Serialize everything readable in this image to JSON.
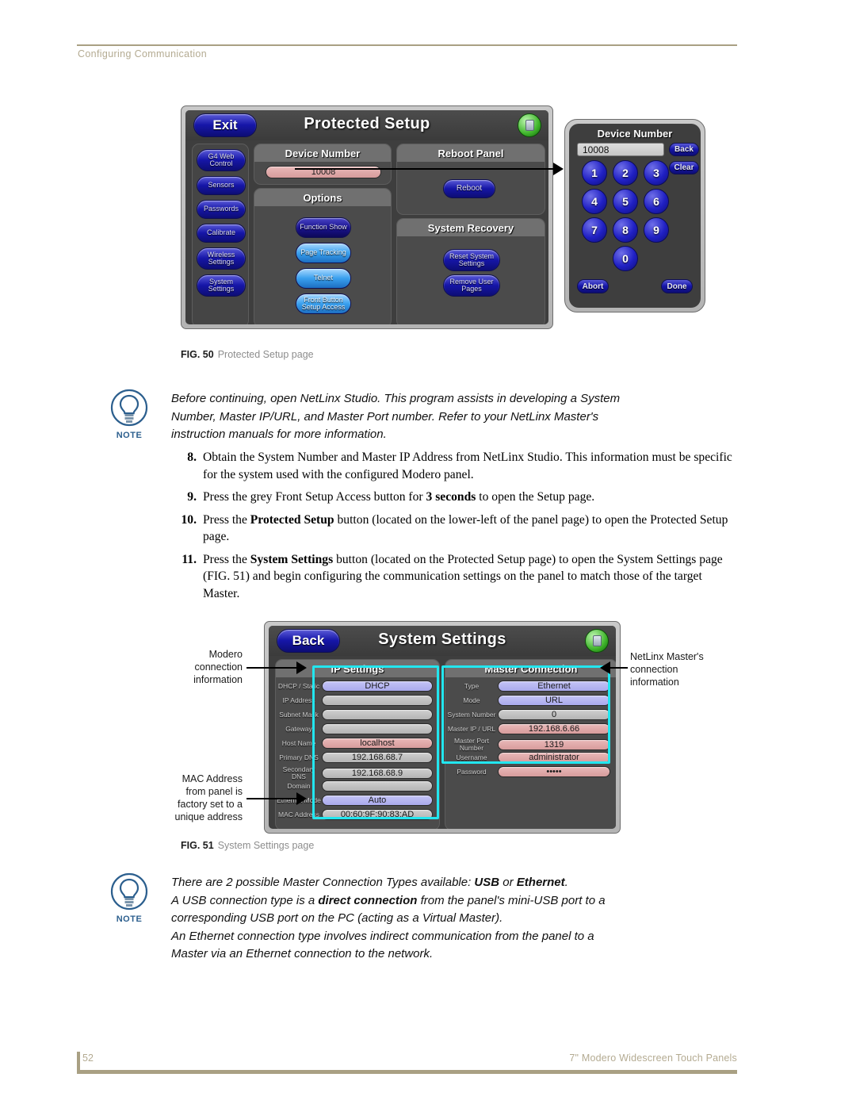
{
  "header": {
    "running_head": "Configuring Communication"
  },
  "footer": {
    "page_number": "52",
    "doc_title": "7\" Modero Widescreen Touch Panels"
  },
  "figure50": {
    "caption_label": "FIG. 50",
    "caption_text": "Protected Setup page",
    "panel": {
      "title": "Protected Setup",
      "exit_button": "Exit",
      "lock_icon": "lock-icon",
      "sidebar_buttons": [
        "G4 Web Control",
        "Sensors",
        "Passwords",
        "Calibrate",
        "Wireless Settings",
        "System Settings"
      ],
      "device_number_group": {
        "title": "Device Number",
        "value": "10008"
      },
      "options_group": {
        "title": "Options",
        "buttons": [
          "Function Show",
          "Page Tracking",
          "Telnet",
          "Front Button Setup Access"
        ]
      },
      "reboot_group": {
        "title": "Reboot Panel",
        "button": "Reboot"
      },
      "recovery_group": {
        "title": "System Recovery",
        "buttons": [
          "Reset System Settings",
          "Remove User Pages"
        ]
      }
    },
    "keypad": {
      "title": "Device Number",
      "field_value": "10008",
      "side_buttons": [
        "Back",
        "Clear"
      ],
      "digits": [
        "1",
        "2",
        "3",
        "4",
        "5",
        "6",
        "7",
        "8",
        "9",
        "0"
      ],
      "abort_button": "Abort",
      "done_button": "Done"
    }
  },
  "note1": {
    "icon_label": "NOTE",
    "lines": [
      "Before continuing, open NetLinx Studio. This program assists in developing a System",
      "Number, Master IP/URL, and Master Port number. Refer to your NetLinx Master's",
      "instruction manuals for more information."
    ]
  },
  "steps": [
    {
      "num": "8.",
      "html": "Obtain the System Number and Master IP Address from NetLinx Studio. This information must be specific for the system used with the configured Modero panel."
    },
    {
      "num": "9.",
      "html": "Press the grey Front Setup Access button for <b>3 seconds</b> to open the Setup page."
    },
    {
      "num": "10.",
      "html": "Press the <b>Protected Setup</b> button (located on the lower-left of the panel page) to open the Protected Setup page."
    },
    {
      "num": "11.",
      "html": "Press the <b>System Settings</b> button (located on the Protected Setup page) to open the System Settings page (FIG. 51) and begin configuring the communication settings on the panel to match those of the target Master."
    }
  ],
  "figure51": {
    "caption_label": "FIG. 51",
    "caption_text": "System Settings page",
    "panel": {
      "title": "System Settings",
      "back_button": "Back",
      "lock_icon": "lock-icon",
      "ip_settings": {
        "title": "IP Settings",
        "rows": [
          {
            "label": "DHCP / Static",
            "value": "DHCP",
            "style": "blue"
          },
          {
            "label": "IP Address",
            "value": "",
            "style": "grey"
          },
          {
            "label": "Subnet Mask",
            "value": "",
            "style": "grey"
          },
          {
            "label": "Gateway",
            "value": "",
            "style": "grey"
          },
          {
            "label": "Host Name",
            "value": "localhost",
            "style": "rose"
          },
          {
            "label": "Primary DNS",
            "value": "192.168.68.7",
            "style": "grey"
          },
          {
            "label": "Secondary DNS",
            "value": "192.168.68.9",
            "style": "grey"
          },
          {
            "label": "Domain",
            "value": "",
            "style": "grey"
          },
          {
            "label": "Ethernet Mode",
            "value": "Auto",
            "style": "blue"
          },
          {
            "label": "MAC Address",
            "value": "00:60:9F:90:83:AD",
            "style": "grey"
          }
        ]
      },
      "master_connection": {
        "title": "Master Connection",
        "rows": [
          {
            "label": "Type",
            "value": "Ethernet",
            "style": "blue"
          },
          {
            "label": "Mode",
            "value": "URL",
            "style": "blue"
          },
          {
            "label": "System Number",
            "value": "0",
            "style": "grey"
          },
          {
            "label": "Master IP / URL",
            "value": "192.168.6.66",
            "style": "rose"
          },
          {
            "label": "Master Port Number",
            "value": "1319",
            "style": "rose"
          },
          {
            "label": "Username",
            "value": "administrator",
            "style": "rose"
          },
          {
            "label": "Password",
            "value": "•••••",
            "style": "rose"
          }
        ]
      }
    },
    "annotations": {
      "left_top": "Modero\nconnection\ninformation",
      "left_bottom": "MAC Address\nfrom panel is\nfactory set to a\nunique address",
      "right_top": "NetLinx Master's\nconnection\ninformation"
    }
  },
  "note2": {
    "icon_label": "NOTE",
    "lines_html": [
      "There are 2 possible Master Connection Types available: <b>USB</b> or <b>Ethernet</b>.",
      "A USB connection type is a <b>direct connection</b> from the panel's mini-USB port to a",
      "corresponding USB port on the PC (acting as a Virtual Master).",
      "An Ethernet connection type involves indirect communication from the panel to a",
      "Master via an Ethernet connection to the network."
    ]
  },
  "colors": {
    "header_rule": "#a9a083",
    "header_text": "#b4ab92",
    "note_blue": "#2c5f8e",
    "cyan_highlight": "#22e6ef",
    "panel_bezel": "#c0c0c0",
    "panel_screen": "#3e3e3e",
    "button_blue": "#1616a8",
    "button_bright_blue": "#39a0ee",
    "value_rose": "#e0a6a6",
    "value_grey": "#c4c4c4",
    "value_lavender": "#b6b6f0"
  }
}
